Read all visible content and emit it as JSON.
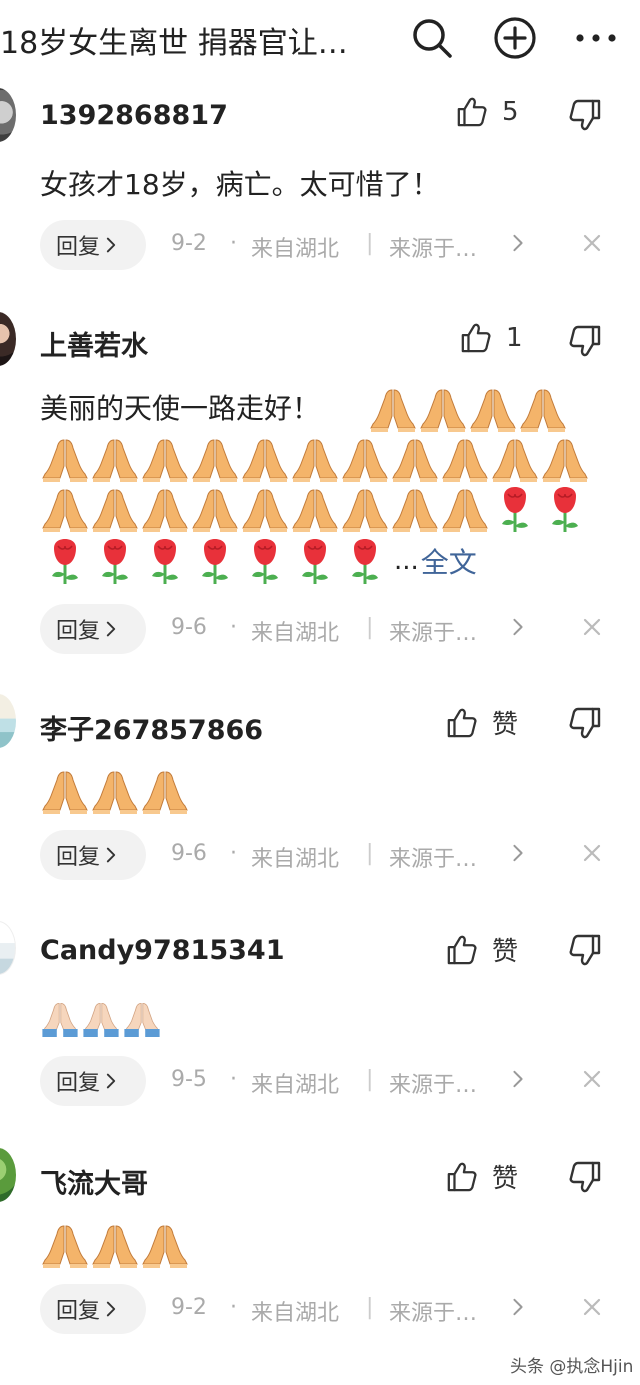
{
  "header": {
    "title": "18岁女生离世  捐器官让…"
  },
  "comments": [
    {
      "username": "1392868817",
      "likes": "5",
      "text": "女孩才18岁，病亡。太可惜了！",
      "reply_label": "回复",
      "date": "9-2",
      "dot": "·",
      "location": "来自湖北",
      "separator": "|",
      "source": "来源于…"
    },
    {
      "username": "上善若水",
      "likes": "1",
      "text": "美丽的天使一路走好！",
      "more_ellipsis": "...",
      "full_text_link": "全文",
      "reply_label": "回复",
      "date": "9-6",
      "dot": "·",
      "location": "来自湖北",
      "separator": "|",
      "source": "来源于…"
    },
    {
      "username": "李子267857866",
      "likes": "赞",
      "reply_label": "回复",
      "date": "9-6",
      "dot": "·",
      "location": "来自湖北",
      "separator": "|",
      "source": "来源于…"
    },
    {
      "username": "Candy97815341",
      "likes": "赞",
      "reply_label": "回复",
      "date": "9-5",
      "dot": "·",
      "location": "来自湖北",
      "separator": "|",
      "source": "来源于…"
    },
    {
      "username": "飞流大哥",
      "likes": "赞",
      "reply_label": "回复",
      "date": "9-2",
      "dot": "·",
      "location": "来自湖北",
      "separator": "|",
      "source": "来源于…"
    }
  ],
  "watermark": "头条 @执念Hjin",
  "icons": {
    "search": "search-icon",
    "add": "plus-circle-icon",
    "more": "more-dots-icon",
    "like": "thumbs-up-icon",
    "dislike": "thumbs-down-icon",
    "pray": "folded-hands-emoji",
    "rose": "rose-emoji",
    "close": "close-icon",
    "chevron": "chevron-right-icon"
  },
  "colors": {
    "link": "#406599",
    "meta": "#aaaaaa",
    "reply_bg": "#f2f2f2",
    "pray_skin": "#f4b46a",
    "pray_light_skin": "#f6d6bd",
    "pray_cuff": "#5b9bd5",
    "rose_red": "#e8313a",
    "rose_stem": "#4caf50"
  }
}
